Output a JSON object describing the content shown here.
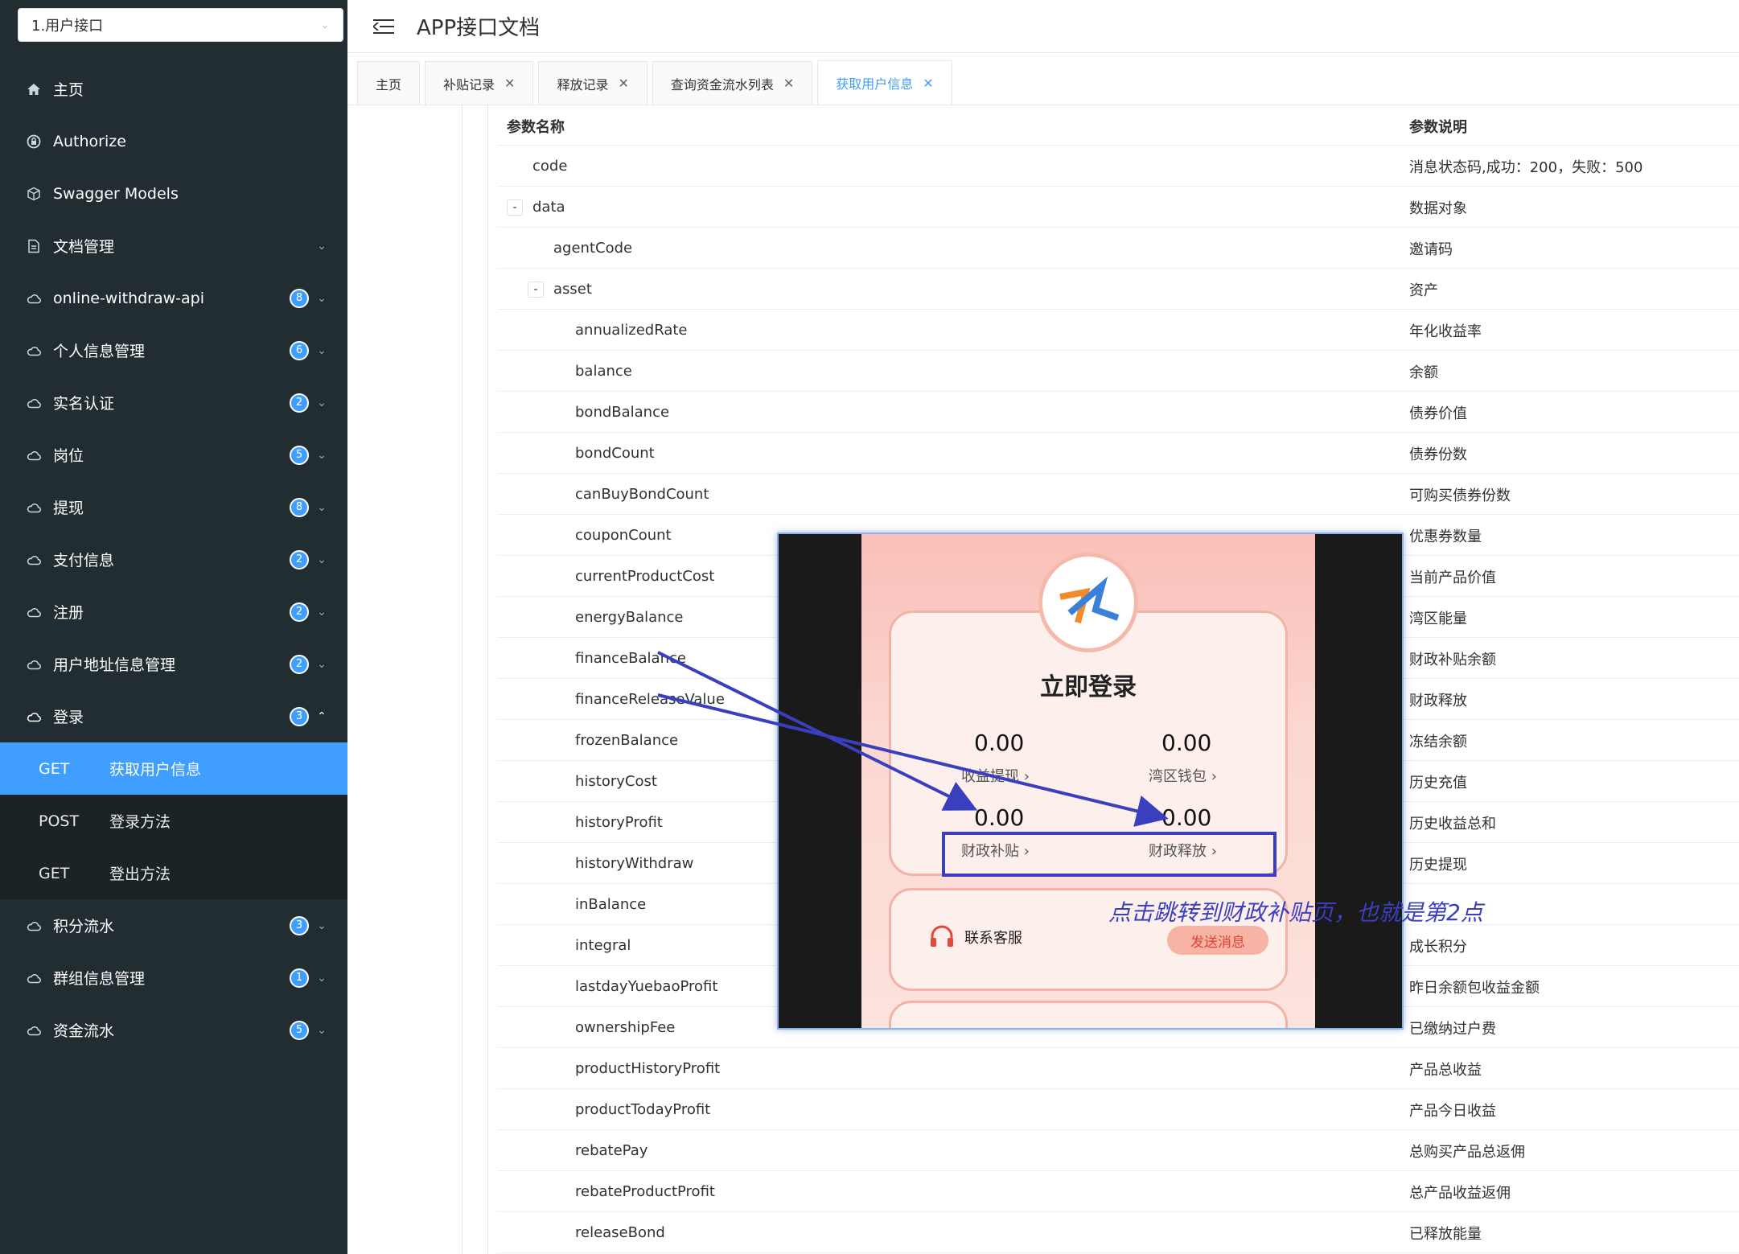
{
  "app_select": {
    "value": "1.用户接口"
  },
  "header": {
    "title": "APP接口文档"
  },
  "sidebar": {
    "items": [
      {
        "label": "主页",
        "icon": "home-icon"
      },
      {
        "label": "Authorize",
        "icon": "lock-icon"
      },
      {
        "label": "Swagger Models",
        "icon": "cube-icon"
      },
      {
        "label": "文档管理",
        "icon": "document-icon",
        "arrow": "down"
      },
      {
        "label": "online-withdraw-api",
        "icon": "cloud-icon",
        "badge": "8",
        "arrow": "down"
      },
      {
        "label": "个人信息管理",
        "icon": "cloud-icon",
        "badge": "6",
        "arrow": "down"
      },
      {
        "label": "实名认证",
        "icon": "cloud-icon",
        "badge": "2",
        "arrow": "down"
      },
      {
        "label": "岗位",
        "icon": "cloud-icon",
        "badge": "5",
        "arrow": "down"
      },
      {
        "label": "提现",
        "icon": "cloud-icon",
        "badge": "8",
        "arrow": "down"
      },
      {
        "label": "支付信息",
        "icon": "cloud-icon",
        "badge": "2",
        "arrow": "down"
      },
      {
        "label": "注册",
        "icon": "cloud-icon",
        "badge": "2",
        "arrow": "down"
      },
      {
        "label": "用户地址信息管理",
        "icon": "cloud-icon",
        "badge": "2",
        "arrow": "down"
      },
      {
        "label": "登录",
        "icon": "cloud-icon",
        "badge": "3",
        "arrow": "up"
      }
    ],
    "login_sub": [
      {
        "method": "GET",
        "label": "获取用户信息",
        "active": true
      },
      {
        "method": "POST",
        "label": "登录方法"
      },
      {
        "method": "GET",
        "label": "登出方法"
      }
    ],
    "items_after": [
      {
        "label": "积分流水",
        "icon": "cloud-icon",
        "badge": "3",
        "arrow": "down"
      },
      {
        "label": "群组信息管理",
        "icon": "cloud-icon",
        "badge": "1",
        "arrow": "down"
      },
      {
        "label": "资金流水",
        "icon": "cloud-icon",
        "badge": "5",
        "arrow": "down"
      }
    ]
  },
  "tabs": [
    {
      "label": "主页",
      "closable": false
    },
    {
      "label": "补贴记录",
      "closable": true
    },
    {
      "label": "释放记录",
      "closable": true
    },
    {
      "label": "查询资金流水列表",
      "closable": true
    },
    {
      "label": "获取用户信息",
      "closable": true,
      "active": true
    }
  ],
  "table": {
    "col_name": "参数名称",
    "col_desc": "参数说明",
    "rows": [
      {
        "name": "code",
        "level": 1,
        "desc": "消息状态码,成功：200，失败：500"
      },
      {
        "name": "data",
        "level": 0,
        "toggle": "-",
        "desc": "数据对象"
      },
      {
        "name": "agentCode",
        "level": 2,
        "desc": "邀请码"
      },
      {
        "name": "asset",
        "level": 1,
        "toggle": "-",
        "desc": "资产"
      },
      {
        "name": "annualizedRate",
        "level": 3,
        "desc": "年化收益率"
      },
      {
        "name": "balance",
        "level": 3,
        "desc": "余额"
      },
      {
        "name": "bondBalance",
        "level": 3,
        "desc": "债券价值"
      },
      {
        "name": "bondCount",
        "level": 3,
        "desc": "债券份数"
      },
      {
        "name": "canBuyBondCount",
        "level": 3,
        "desc": "可购买债券份数"
      },
      {
        "name": "couponCount",
        "level": 3,
        "desc": "优惠券数量"
      },
      {
        "name": "currentProductCost",
        "level": 3,
        "desc": "当前产品价值"
      },
      {
        "name": "energyBalance",
        "level": 3,
        "desc": "湾区能量"
      },
      {
        "name": "financeBalance",
        "level": 3,
        "desc": "财政补贴余额"
      },
      {
        "name": "financeReleaseValue",
        "level": 3,
        "desc": "财政释放"
      },
      {
        "name": "frozenBalance",
        "level": 3,
        "desc": "冻结余额"
      },
      {
        "name": "historyCost",
        "level": 3,
        "desc": "历史充值"
      },
      {
        "name": "historyProfit",
        "level": 3,
        "desc": "历史收益总和"
      },
      {
        "name": "historyWithdraw",
        "level": 3,
        "desc": "历史提现"
      },
      {
        "name": "inBalance",
        "level": 3,
        "desc": ""
      },
      {
        "name": "integral",
        "level": 3,
        "desc": "成长积分"
      },
      {
        "name": "lastdayYuebaoProfit",
        "level": 3,
        "desc": "昨日余额包收益金额"
      },
      {
        "name": "ownershipFee",
        "level": 3,
        "desc": "已缴纳过户费"
      },
      {
        "name": "productHistoryProfit",
        "level": 3,
        "desc": "产品总收益"
      },
      {
        "name": "productTodayProfit",
        "level": 3,
        "desc": "产品今日收益"
      },
      {
        "name": "rebatePay",
        "level": 3,
        "desc": "总购买产品总返佣"
      },
      {
        "name": "rebateProductProfit",
        "level": 3,
        "desc": "总产品收益返佣"
      },
      {
        "name": "releaseBond",
        "level": 3,
        "desc": "已释放能量"
      }
    ]
  },
  "phone": {
    "title": "立即登录",
    "amounts": [
      {
        "value": "0.00",
        "label": "收益提现 ›"
      },
      {
        "value": "0.00",
        "label": "湾区钱包 ›"
      },
      {
        "value": "0.00",
        "label": "财政补贴 ›"
      },
      {
        "value": "0.00",
        "label": "财政释放 ›"
      }
    ],
    "service_label": "联系客服",
    "send_label": "发送消息"
  },
  "annotation": "点击跳转到财政补贴页，也就是第2点",
  "colors": {
    "accent": "#409eff",
    "sidebar_bg": "#222d32",
    "annotation": "#3a3fbf"
  }
}
